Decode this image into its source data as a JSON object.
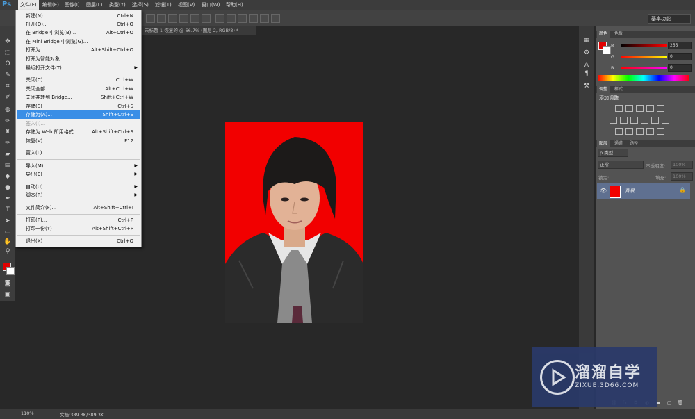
{
  "app": {
    "logo": "Ps"
  },
  "menubar": [
    "文件(F)",
    "编辑(E)",
    "图像(I)",
    "图层(L)",
    "类型(Y)",
    "选择(S)",
    "滤镜(T)",
    "视图(V)",
    "窗口(W)",
    "帮助(H)"
  ],
  "workspace": "基本功能",
  "document": {
    "tab_title": "未标题-1-恢复的 @ 66.7% (图层 2, RGB/8) *"
  },
  "file_menu": {
    "items": [
      {
        "label": "新建(N)...",
        "shortcut": "Ctrl+N"
      },
      {
        "label": "打开(O)...",
        "shortcut": "Ctrl+O"
      },
      {
        "label": "在 Bridge 中浏览(B)...",
        "shortcut": "Alt+Ctrl+O"
      },
      {
        "label": "在 Mini Bridge 中浏览(G)...",
        "shortcut": ""
      },
      {
        "label": "打开为...",
        "shortcut": "Alt+Shift+Ctrl+O"
      },
      {
        "label": "打开为智能对象...",
        "shortcut": ""
      },
      {
        "label": "最近打开文件(T)",
        "shortcut": ""
      },
      {
        "label": "关闭(C)",
        "shortcut": "Ctrl+W"
      },
      {
        "label": "关闭全部",
        "shortcut": "Alt+Ctrl+W"
      },
      {
        "label": "关闭并转到 Bridge...",
        "shortcut": "Shift+Ctrl+W"
      },
      {
        "label": "存储(S)",
        "shortcut": "Ctrl+S"
      },
      {
        "label": "存储为(A)...",
        "shortcut": "Shift+Ctrl+S"
      },
      {
        "label": "签入(I)...",
        "shortcut": ""
      },
      {
        "label": "存储为 Web 所用格式...",
        "shortcut": "Alt+Shift+Ctrl+S"
      },
      {
        "label": "恢复(V)",
        "shortcut": "F12"
      },
      {
        "label": "置入(L)...",
        "shortcut": ""
      },
      {
        "label": "导入(M)",
        "shortcut": ""
      },
      {
        "label": "导出(E)",
        "shortcut": ""
      },
      {
        "label": "自动(U)",
        "shortcut": ""
      },
      {
        "label": "脚本(R)",
        "shortcut": ""
      },
      {
        "label": "文件简介(F)...",
        "shortcut": "Alt+Shift+Ctrl+I"
      },
      {
        "label": "打印(P)...",
        "shortcut": "Ctrl+P"
      },
      {
        "label": "打印一份(Y)",
        "shortcut": "Alt+Shift+Ctrl+P"
      },
      {
        "label": "退出(X)",
        "shortcut": "Ctrl+Q"
      }
    ]
  },
  "color_panel": {
    "tabs": [
      "颜色",
      "色板"
    ],
    "channels": [
      {
        "name": "R",
        "value": "255"
      },
      {
        "name": "G",
        "value": "0"
      },
      {
        "name": "B",
        "value": "0"
      }
    ]
  },
  "adjust_panel": {
    "tabs": [
      "调整",
      "样式"
    ],
    "title": "添加调整"
  },
  "layers_panel": {
    "tabs": [
      "图层",
      "通道",
      "路径"
    ],
    "filter": "ρ 类型",
    "blend_mode": "正常",
    "opacity_label": "不透明度:",
    "opacity_value": "100%",
    "lock_label": "锁定:",
    "fill_label": "填充:",
    "fill_value": "100%",
    "layers": [
      {
        "name": "背景"
      }
    ]
  },
  "status": {
    "zoom": "110%",
    "doc_size": "文档:389.3K/389.3K"
  },
  "watermark": {
    "title": "溜溜自学",
    "url": "ZIXUE.3D66.COM"
  },
  "colors": {
    "foreground": "#e00000",
    "background": "#ffffff",
    "highlight": "#3a8ee6",
    "photo_bg": "#f20000"
  }
}
